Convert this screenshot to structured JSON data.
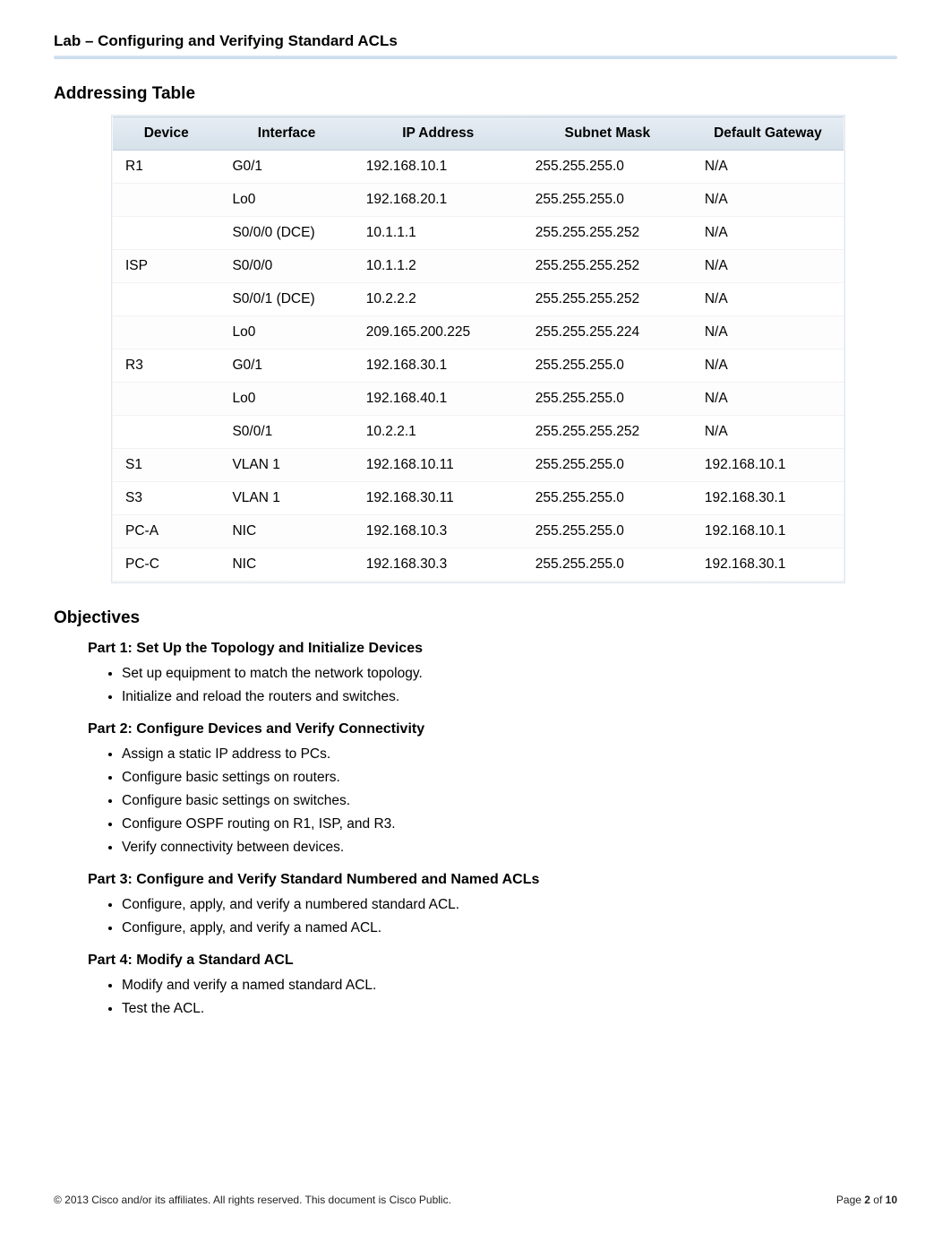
{
  "header": {
    "title": "Lab – Configuring and Verifying Standard ACLs"
  },
  "addressing": {
    "heading": "Addressing Table",
    "columns": [
      "Device",
      "Interface",
      "IP Address",
      "Subnet Mask",
      "Default Gateway"
    ],
    "rows": [
      {
        "device": "R1",
        "interface": "G0/1",
        "ip": "192.168.10.1",
        "mask": "255.255.255.0",
        "gateway": "N/A"
      },
      {
        "device": "",
        "interface": "Lo0",
        "ip": "192.168.20.1",
        "mask": "255.255.255.0",
        "gateway": "N/A"
      },
      {
        "device": "",
        "interface": "S0/0/0 (DCE)",
        "ip": "10.1.1.1",
        "mask": "255.255.255.252",
        "gateway": "N/A"
      },
      {
        "device": "ISP",
        "interface": "S0/0/0",
        "ip": "10.1.1.2",
        "mask": "255.255.255.252",
        "gateway": "N/A"
      },
      {
        "device": "",
        "interface": "S0/0/1 (DCE)",
        "ip": "10.2.2.2",
        "mask": "255.255.255.252",
        "gateway": "N/A"
      },
      {
        "device": "",
        "interface": "Lo0",
        "ip": "209.165.200.225",
        "mask": "255.255.255.224",
        "gateway": "N/A"
      },
      {
        "device": "R3",
        "interface": "G0/1",
        "ip": "192.168.30.1",
        "mask": "255.255.255.0",
        "gateway": "N/A"
      },
      {
        "device": "",
        "interface": "Lo0",
        "ip": "192.168.40.1",
        "mask": "255.255.255.0",
        "gateway": "N/A"
      },
      {
        "device": "",
        "interface": "S0/0/1",
        "ip": "10.2.2.1",
        "mask": "255.255.255.252",
        "gateway": "N/A"
      },
      {
        "device": "S1",
        "interface": "VLAN 1",
        "ip": "192.168.10.11",
        "mask": "255.255.255.0",
        "gateway": "192.168.10.1"
      },
      {
        "device": "S3",
        "interface": "VLAN 1",
        "ip": "192.168.30.11",
        "mask": "255.255.255.0",
        "gateway": "192.168.30.1"
      },
      {
        "device": "PC-A",
        "interface": "NIC",
        "ip": "192.168.10.3",
        "mask": "255.255.255.0",
        "gateway": "192.168.10.1"
      },
      {
        "device": "PC-C",
        "interface": "NIC",
        "ip": "192.168.30.3",
        "mask": "255.255.255.0",
        "gateway": "192.168.30.1"
      }
    ]
  },
  "objectives": {
    "heading": "Objectives",
    "parts": [
      {
        "title": "Part 1: Set Up the Topology and Initialize Devices",
        "items": [
          "Set up equipment to match the network topology.",
          "Initialize and reload the routers and switches."
        ]
      },
      {
        "title": "Part 2: Configure Devices and Verify Connectivity",
        "items": [
          "Assign a static IP address to PCs.",
          "Configure basic settings on routers.",
          "Configure basic settings on switches.",
          "Configure OSPF routing on R1, ISP, and R3.",
          "Verify connectivity between devices."
        ]
      },
      {
        "title": "Part 3: Configure and Verify Standard Numbered and Named ACLs",
        "items": [
          "Configure, apply, and verify a numbered standard ACL.",
          "Configure, apply, and verify a named ACL."
        ]
      },
      {
        "title": "Part 4: Modify a Standard ACL",
        "items": [
          "Modify and verify a named standard ACL.",
          "Test the ACL."
        ]
      }
    ]
  },
  "footer": {
    "copyright": "© 2013 Cisco and/or its affiliates. All rights reserved. This document is Cisco Public.",
    "page_prefix": "Page ",
    "page_current": "2",
    "page_of": " of ",
    "page_total": "10"
  }
}
